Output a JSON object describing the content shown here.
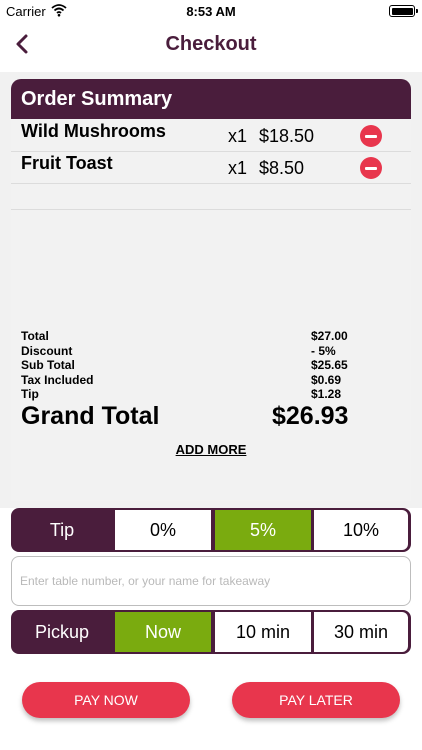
{
  "status_bar": {
    "carrier": "Carrier",
    "time": "8:53 AM"
  },
  "nav": {
    "title": "Checkout"
  },
  "summary": {
    "title": "Order Summary",
    "items": [
      {
        "name": "Wild Mushrooms",
        "qty": "x1",
        "price": "$18.50"
      },
      {
        "name": "Fruit Toast",
        "qty": "x1",
        "price": "$8.50"
      }
    ],
    "totals": [
      {
        "label": "Total",
        "value": "$27.00"
      },
      {
        "label": "Discount",
        "value": " - 5%"
      },
      {
        "label": "Sub Total",
        "value": "$25.65"
      },
      {
        "label": "Tax Included",
        "value": "$0.69"
      },
      {
        "label": "Tip",
        "value": "$1.28"
      }
    ],
    "grand_total_label": "Grand Total",
    "grand_total_value": "$26.93",
    "add_more": "ADD MORE"
  },
  "tip": {
    "label": "Tip",
    "options": [
      "0%",
      "5%",
      "10%"
    ],
    "selected": "5%"
  },
  "table_field": {
    "placeholder": "Enter table number, or your name for takeaway",
    "value": ""
  },
  "pickup": {
    "label": "Pickup",
    "options": [
      "Now",
      "10 min",
      "30 min"
    ],
    "selected": "Now"
  },
  "actions": {
    "pay_now": "PAY NOW",
    "pay_later": "PAY LATER"
  },
  "colors": {
    "brand": "#4a1d3c",
    "selected": "#7aab0f",
    "accent": "#e8364d"
  }
}
